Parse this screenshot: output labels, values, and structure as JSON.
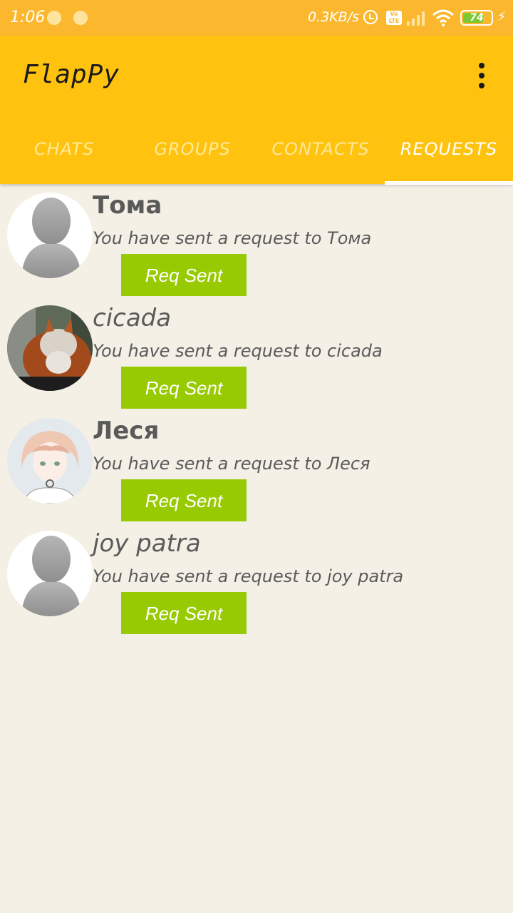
{
  "status_bar": {
    "time": "1:06",
    "net_speed": "0.3KB/s",
    "volte_label": "Vo LTE",
    "battery_level": "74",
    "battery_percent": 74,
    "icons": [
      "notification-dot-icon",
      "notification-dot-icon",
      "alarm-icon",
      "volte-icon",
      "signal-icon",
      "wifi-icon",
      "battery-icon",
      "charging-icon"
    ]
  },
  "app_bar": {
    "title": "FlapPy",
    "menu_icon": "overflow-menu-icon"
  },
  "tabs": [
    {
      "label": "CHATS"
    },
    {
      "label": "GROUPS"
    },
    {
      "label": "CONTACTS"
    },
    {
      "label": "REQUESTS"
    }
  ],
  "active_tab": "REQUESTS",
  "requests": [
    {
      "name": "Тома",
      "message": "You have sent a request to Тома",
      "button": "Req Sent",
      "avatar": "default-avatar-icon"
    },
    {
      "name": "cicada",
      "message": "You have sent a request to cicada",
      "button": "Req Sent",
      "avatar": "cat-photo-avatar"
    },
    {
      "name": "Леся",
      "message": "You have sent a request to Леся",
      "button": "Req Sent",
      "avatar": "anime-girl-avatar"
    },
    {
      "name": "joy patra",
      "message": "You have sent a request to joy patra",
      "button": "Req Sent",
      "avatar": "default-avatar-icon"
    }
  ],
  "colors": {
    "status_bar": "#FBB82E",
    "app_bar": "#FFC30F",
    "background": "#F4F0E6",
    "button": "#97CA00",
    "text": "#5a5a5a"
  }
}
